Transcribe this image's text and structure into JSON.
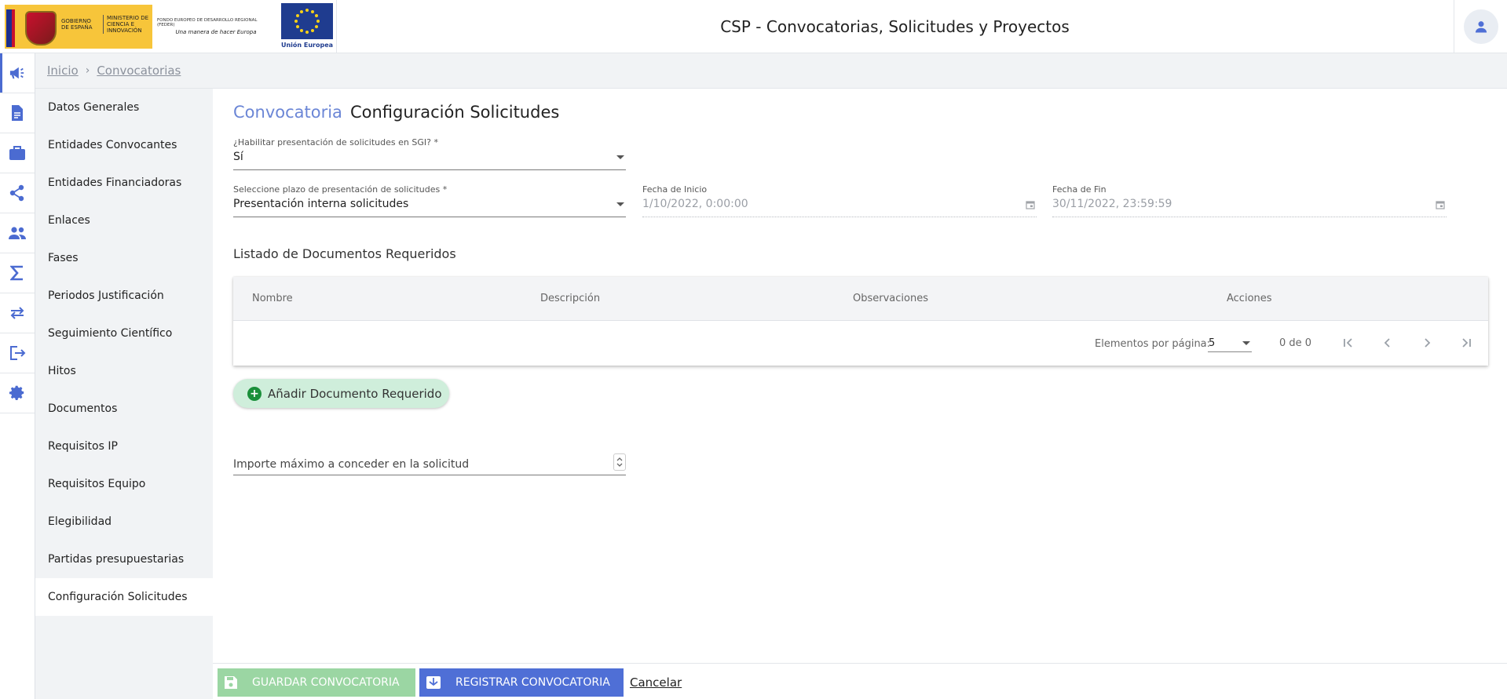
{
  "header": {
    "gobierno_text": "GOBIERNO DE ESPAÑA",
    "ministerio_text": "MINISTERIO DE CIENCIA E INNOVACIÓN",
    "feder_text": "FONDO EUROPEO DE DESARROLLO REGIONAL (FEDER)",
    "feder_slogan": "Una manera de hacer Europa",
    "ue_label": "Unión Europea",
    "app_title": "CSP - Convocatorias, Solicitudes y Proyectos"
  },
  "rail": {
    "items": [
      {
        "icon": "megaphone-icon",
        "active": true
      },
      {
        "icon": "document-icon"
      },
      {
        "icon": "briefcase-icon"
      },
      {
        "icon": "share-icon"
      },
      {
        "icon": "group-icon"
      },
      {
        "icon": "sigma-icon"
      },
      {
        "icon": "swap-arrows-icon"
      },
      {
        "icon": "exit-icon"
      },
      {
        "icon": "gear-icon"
      }
    ]
  },
  "breadcrumb": {
    "home": "Inicio",
    "separator": "›",
    "current": "Convocatorias"
  },
  "submenu": {
    "items": [
      "Datos Generales",
      "Entidades Convocantes",
      "Entidades Financiadoras",
      "Enlaces",
      "Fases",
      "Periodos Justificación",
      "Seguimiento Científico",
      "Hitos",
      "Documentos",
      "Requisitos IP",
      "Requisitos Equipo",
      "Elegibilidad",
      "Partidas presupuestarias",
      "Configuración Solicitudes"
    ],
    "active_index": 13
  },
  "page": {
    "title_prefix": "Convocatoria",
    "title": "Configuración Solicitudes"
  },
  "form": {
    "habilitar": {
      "label": "¿Habilitar presentación de solicitudes en SGI? *",
      "value": "Sí"
    },
    "plazo": {
      "label": "Seleccione plazo de presentación de solicitudes *",
      "value": "Presentación interna solicitudes"
    },
    "fecha_inicio": {
      "label": "Fecha de Inicio",
      "value": "1/10/2022, 0:00:00"
    },
    "fecha_fin": {
      "label": "Fecha de Fin",
      "value": "30/11/2022, 23:59:59"
    },
    "importe": {
      "placeholder": "Importe máximo a conceder en la solicitud"
    }
  },
  "documentos": {
    "section_title": "Listado de Documentos Requeridos",
    "columns": [
      "Nombre",
      "Descripción",
      "Observaciones",
      "Acciones"
    ],
    "rows": [],
    "paginator": {
      "items_per_page_label": "Elementos por página:",
      "items_per_page": "5",
      "range": "0 de 0"
    },
    "add_button": "Añadir Documento Requerido"
  },
  "footer": {
    "save": "GUARDAR CONVOCATORIA",
    "register": "REGISTRAR CONVOCATORIA",
    "cancel": "Cancelar"
  },
  "colors": {
    "accent": "#4f6fd6",
    "title_accent": "#6b86d6",
    "save_green": "#9bd6a3",
    "add_green": "#cfeedb"
  }
}
